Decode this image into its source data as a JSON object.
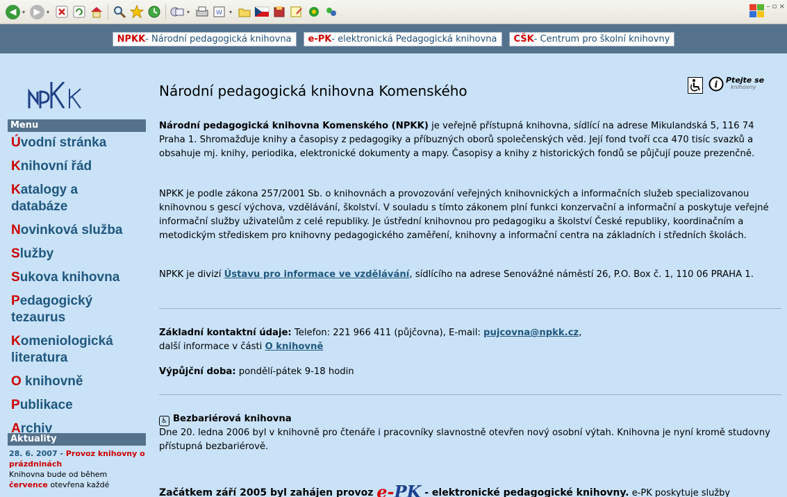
{
  "toolbar": {
    "icons": [
      "back-icon",
      "forward-icon",
      "stop-icon",
      "refresh-icon",
      "home-icon",
      "search-icon",
      "favorites-icon",
      "history-icon",
      "mail-icon",
      "print-icon",
      "edit-icon",
      "folder-icon",
      "flag-icon",
      "research-icon",
      "messenger-icon",
      "plugin-icon"
    ]
  },
  "topband": {
    "links": [
      {
        "abbr": "NPKK",
        "text": " - Národní pedagogická knihovna"
      },
      {
        "abbr": "e-PK",
        "text": " - elektronická Pedagogická knihovna"
      },
      {
        "abbr": "CŠK",
        "text": " - Centrum pro školní knihovny"
      }
    ]
  },
  "sidebar": {
    "menu_title": "Menu",
    "items": [
      {
        "first": "Ú",
        "rest": "vodní stránka"
      },
      {
        "first": "K",
        "rest": "nihovní řád"
      },
      {
        "first": "K",
        "rest": "atalogy a databáze"
      },
      {
        "first": "N",
        "rest": "ovinková služba"
      },
      {
        "first": "S",
        "rest": "lužby"
      },
      {
        "first": "S",
        "rest": "ukova knihovna"
      },
      {
        "first": "P",
        "rest": "edagogický tezaurus"
      },
      {
        "first": "K",
        "rest": "omeniologická literatura"
      },
      {
        "first": "O",
        "rest": " knihovně"
      },
      {
        "first": "P",
        "rest": "ublikace"
      },
      {
        "first": "A",
        "rest": "rchiv"
      }
    ],
    "news_title": "Aktuality",
    "news": {
      "date": "28. 6. 2007 - ",
      "title": "Provoz knihovny o prázdninách",
      "body1": "Knihovna bude od během ",
      "red": "července",
      "body2": " otevřena každé"
    }
  },
  "main": {
    "title": "Národní pedagogická knihovna Komenského",
    "ask_us": "Ptejte se",
    "ask_us_sub": "knihovny",
    "p1_bold": "Národní pedagogická knihovna Komenského (NPKK)",
    "p1_rest": " je veřejně přístupná knihovna, sídlící na adrese Mikulandská 5, 116 74 Praha 1. Shromažďuje knihy a časopisy z pedagogiky a příbuzných oborů společenských věd. Její fond tvoří cca 470 tisíc svazků a obsahuje mj. knihy, periodika, elektronické dokumenty a mapy. Časopisy a knihy z historických fondů se půjčují pouze prezenčně.",
    "p2": "NPKK je podle zákona 257/2001 Sb. o knihovnách a provozování veřejných knihovnických a informačních služeb specializovanou knihovnou s gescí výchova, vzdělávání, školství. V souladu s tímto zákonem plní funkci konzervační a informační a poskytuje veřejné informační služby uživatelům z celé republiky. Je ústřední knihovnou pro pedagogiku a školství České republiky, koordinačním a metodickým střediskem pro knihovny pedagogického zaměření, knihovny a informační centra na základních i středních školách.",
    "p3_a": "NPKK je divizí ",
    "p3_link": "Ústavu pro informace ve vzdělávání",
    "p3_b": ", sídlícího na adrese Senovážné náměstí 26, P.O. Box č. 1, 110 06 PRAHA 1.",
    "contact_label": "Základní kontaktní údaje:",
    "contact_text": " Telefon: 221 966 411 (půjčovna), E-mail: ",
    "contact_email": "pujcovna@npkk.cz",
    "contact_after": ",",
    "contact_more": "další informace v části ",
    "contact_more_link": "O knihovně",
    "hours_label": "Výpůjční doba:",
    "hours_text": " pondělí-pátek 9-18 hodin",
    "barrier_title": "Bezbariérová knihovna",
    "barrier_text": "Dne 20. ledna 2006 byl v knihovně pro čtenáře i pracovníky slavnostně otevřen nový osobní výtah. Knihovna je nyní kromě studovny přístupná bezbariérově.",
    "bottom_a": "Začátkem září 2005 byl zahájen provoz ",
    "bottom_e": "e-",
    "bottom_pk": "PK",
    "bottom_b": " - elektronické pedagogické knihovny.",
    "bottom_c": " e-PK poskytuje služby"
  }
}
